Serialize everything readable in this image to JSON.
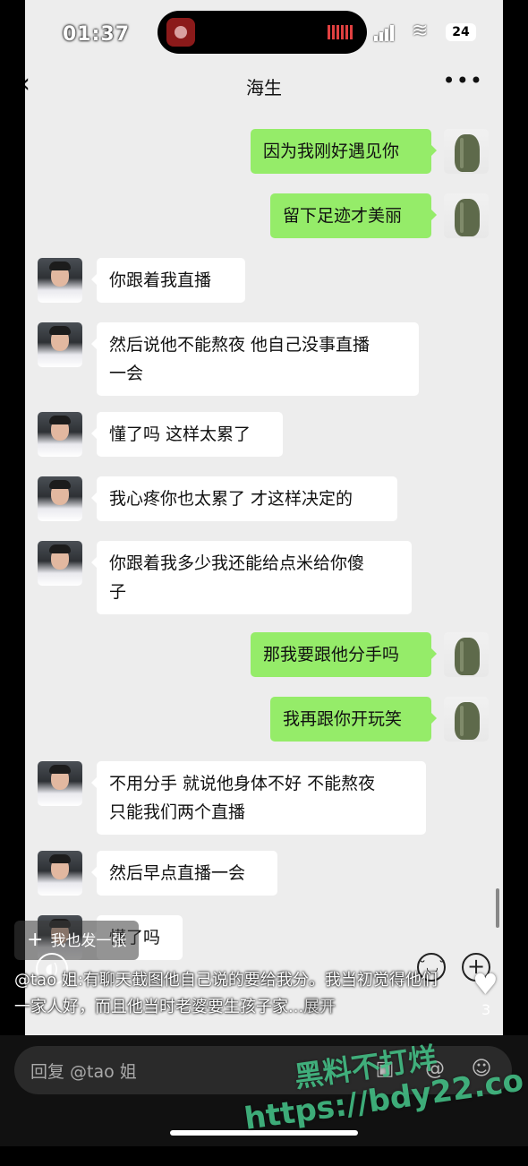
{
  "status_bar": {
    "time": "01:37",
    "battery": "24"
  },
  "nav": {
    "back_icon": "chevron-left-icon",
    "title": "海生",
    "more_icon": "more-dots-icon"
  },
  "messages": [
    {
      "side": "me",
      "text": "因为我刚好遇见你"
    },
    {
      "side": "me",
      "text": "留下足迹才美丽"
    },
    {
      "side": "them",
      "text": "你跟着我直播"
    },
    {
      "side": "them",
      "text": "然后说他不能熬夜 他自己没事直播\n一会"
    },
    {
      "side": "them",
      "text": "懂了吗 这样太累了"
    },
    {
      "side": "them",
      "text": "我心疼你也太累了 才这样决定的"
    },
    {
      "side": "them",
      "text": "你跟着我多少我还能给点米给你傻\n子"
    },
    {
      "side": "me",
      "text": "那我要跟他分手吗"
    },
    {
      "side": "me",
      "text": "我再跟你开玩笑"
    },
    {
      "side": "them",
      "text": "不用分手 就说他身体不好 不能熬夜\n只能我们两个直播"
    },
    {
      "side": "them",
      "text": "然后早点直播一会"
    },
    {
      "side": "them",
      "text": "懂了吗"
    }
  ],
  "overlay": {
    "post_button": "我也发一张",
    "caption": "@tao 姐:有聊天截图他自己说的要给我分。我当初觉得他们一家人好，而且他当时老婆要生孩子家...",
    "expand_label": "展开",
    "like_count": "3"
  },
  "reply": {
    "placeholder": "回复 @tao 姐"
  },
  "watermark": {
    "line1": "黑料不打烊",
    "line2": "https://bdy22.co"
  }
}
